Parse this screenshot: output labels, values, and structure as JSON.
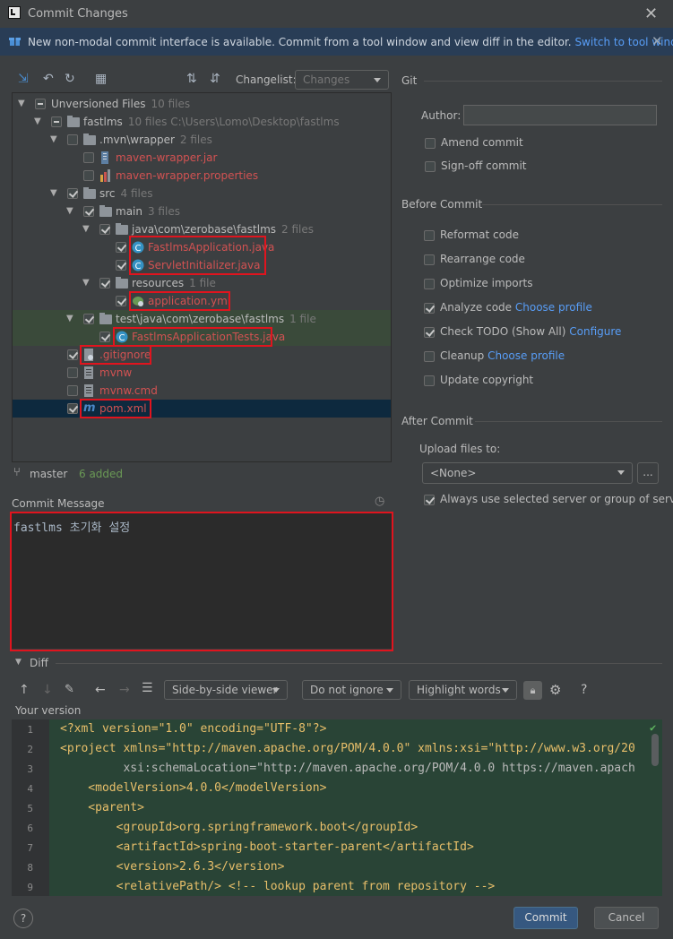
{
  "window": {
    "title": "Commit Changes"
  },
  "banner": {
    "text": "New non-modal commit interface is available. Commit from a tool window and view diff in the editor. ",
    "link": "Switch to tool window"
  },
  "toolbar": {
    "changelist_label": "Changelist:",
    "changelist_value": "Changes"
  },
  "tree": [
    {
      "label": "Unversioned Files",
      "count": "10 files"
    },
    {
      "label": "fastlms",
      "count": "10 files  C:\\Users\\Lomo\\Desktop\\fastlms"
    },
    {
      "label": ".mvn\\wrapper",
      "count": "2 files"
    },
    {
      "label": "maven-wrapper.jar",
      "count": ""
    },
    {
      "label": "maven-wrapper.properties",
      "count": ""
    },
    {
      "label": "src",
      "count": "4 files"
    },
    {
      "label": "main",
      "count": "3 files"
    },
    {
      "label": "java\\com\\zerobase\\fastlms",
      "count": "2 files"
    },
    {
      "label": "FastlmsApplication.java",
      "count": ""
    },
    {
      "label": "ServletInitializer.java",
      "count": ""
    },
    {
      "label": "resources",
      "count": "1 file"
    },
    {
      "label": "application.yml",
      "count": ""
    },
    {
      "label": "test\\java\\com\\zerobase\\fastlms",
      "count": "1 file"
    },
    {
      "label": "FastlmsApplicationTests.java",
      "count": ""
    },
    {
      "label": ".gitignore",
      "count": ""
    },
    {
      "label": "mvnw",
      "count": ""
    },
    {
      "label": "mvnw.cmd",
      "count": ""
    },
    {
      "label": "pom.xml",
      "count": ""
    }
  ],
  "status": {
    "branch": "master",
    "added": "6 added"
  },
  "commit_message": {
    "label": "Commit Message",
    "text": "fastlms 초기화 설정"
  },
  "git": {
    "section": "Git",
    "author_label": "Author:",
    "amend": "Amend commit",
    "signoff": "Sign-off commit"
  },
  "before_commit": {
    "section": "Before Commit",
    "reformat": "Reformat code",
    "rearrange": "Rearrange code",
    "optimize": "Optimize imports",
    "analyze": "Analyze code",
    "analyze_link": "Choose profile",
    "todo": "Check TODO (Show All)",
    "todo_link": "Configure",
    "cleanup": "Cleanup",
    "cleanup_link": "Choose profile",
    "copyright": "Update copyright"
  },
  "after_commit": {
    "section": "After Commit",
    "upload_label": "Upload files to:",
    "upload_value": "<None>",
    "browse": "...",
    "always_use": "Always use selected server or group of servers"
  },
  "diff": {
    "section": "Diff",
    "viewer": "Side-by-side viewer",
    "ignore": "Do not ignore",
    "highlight": "Highlight words",
    "help": "?",
    "your_version": "Your version",
    "line_numbers": [
      "1",
      "2",
      "3",
      "4",
      "5",
      "6",
      "7",
      "8",
      "9"
    ],
    "lines": [
      "<?xml version=\"1.0\" encoding=\"UTF-8\"?>",
      "<project xmlns=\"http://maven.apache.org/POM/4.0.0\" xmlns:xsi=\"http://www.w3.org/20",
      "         xsi:schemaLocation=\"http://maven.apache.org/POM/4.0.0 https://maven.apach",
      "    <modelVersion>4.0.0</modelVersion>",
      "    <parent>",
      "        <groupId>org.springframework.boot</groupId>",
      "        <artifactId>spring-boot-starter-parent</artifactId>",
      "        <version>2.6.3</version>",
      "        <relativePath/> <!-- lookup parent from repository -->"
    ]
  },
  "footer": {
    "help": "?",
    "commit": "Commit",
    "cancel": "Cancel"
  }
}
